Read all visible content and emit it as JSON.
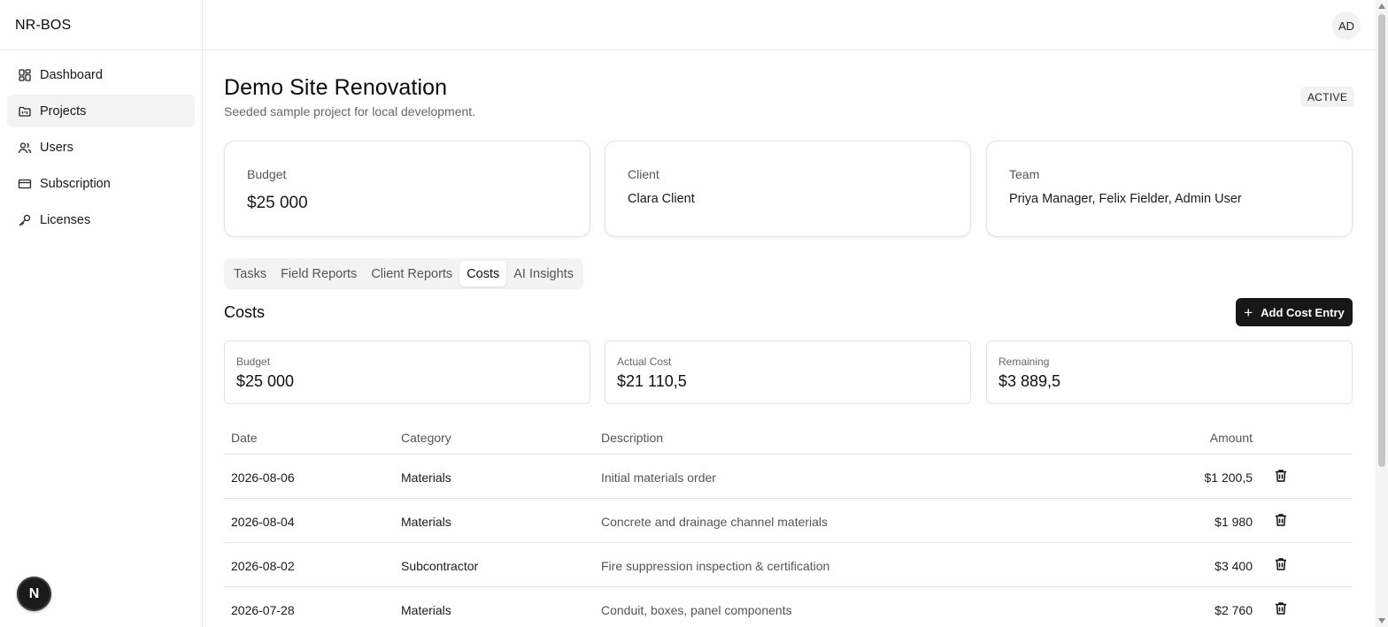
{
  "app": {
    "brand": "NR-BOS",
    "avatar_initials": "AD",
    "dev_badge": "N"
  },
  "sidebar": {
    "items": [
      {
        "label": "Dashboard",
        "icon": "dashboard-icon",
        "active": false
      },
      {
        "label": "Projects",
        "icon": "folder-kanban-icon",
        "active": true
      },
      {
        "label": "Users",
        "icon": "users-icon",
        "active": false
      },
      {
        "label": "Subscription",
        "icon": "credit-card-icon",
        "active": false
      },
      {
        "label": "Licenses",
        "icon": "key-icon",
        "active": false
      }
    ]
  },
  "project": {
    "title": "Demo Site Renovation",
    "subtitle": "Seeded sample project for local development.",
    "status": "ACTIVE"
  },
  "info_cards": {
    "budget": {
      "label": "Budget",
      "value": "$25 000"
    },
    "client": {
      "label": "Client",
      "value": "Clara Client"
    },
    "team": {
      "label": "Team",
      "value": "Priya Manager, Felix Fielder, Admin User"
    }
  },
  "tabs": [
    {
      "label": "Tasks",
      "active": false
    },
    {
      "label": "Field Reports",
      "active": false
    },
    {
      "label": "Client Reports",
      "active": false
    },
    {
      "label": "Costs",
      "active": true
    },
    {
      "label": "AI Insights",
      "active": false
    }
  ],
  "costs": {
    "title": "Costs",
    "add_button": "Add Cost Entry",
    "summary": {
      "budget": {
        "label": "Budget",
        "value": "$25 000"
      },
      "actual": {
        "label": "Actual Cost",
        "value": "$21 110,5"
      },
      "remaining": {
        "label": "Remaining",
        "value": "$3 889,5"
      }
    },
    "columns": {
      "date": "Date",
      "category": "Category",
      "description": "Description",
      "amount": "Amount"
    },
    "rows": [
      {
        "date": "2026-08-06",
        "category": "Materials",
        "description": "Initial materials order",
        "amount": "$1 200,5"
      },
      {
        "date": "2026-08-04",
        "category": "Materials",
        "description": "Concrete and drainage channel materials",
        "amount": "$1 980"
      },
      {
        "date": "2026-08-02",
        "category": "Subcontractor",
        "description": "Fire suppression inspection & certification",
        "amount": "$3 400"
      },
      {
        "date": "2026-07-28",
        "category": "Materials",
        "description": "Conduit, boxes, panel components",
        "amount": "$2 760"
      }
    ]
  }
}
